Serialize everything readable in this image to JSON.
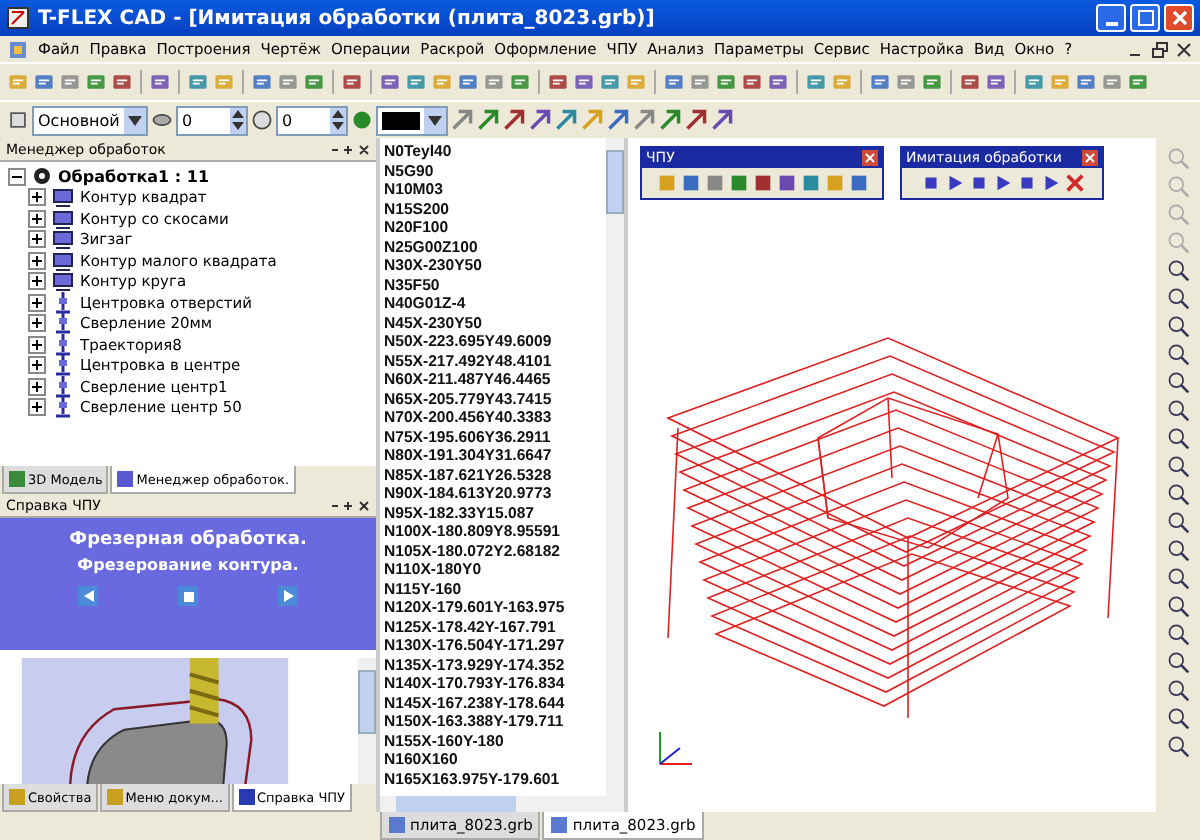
{
  "window": {
    "title": "T-FLEX CAD - [Имитация обработки (плита_8023.grb)]"
  },
  "menu": [
    "Файл",
    "Правка",
    "Построения",
    "Чертёж",
    "Операции",
    "Раскрой",
    "Оформление",
    "ЧПУ",
    "Анализ",
    "Параметры",
    "Сервис",
    "Настройка",
    "Вид",
    "Окно",
    "?"
  ],
  "toolbar": {
    "layer": "Основной",
    "level_1": "0",
    "level_2": "0"
  },
  "manager": {
    "title": "Менеджер обработок",
    "tree": [
      {
        "label": "Обработка1 : 11",
        "expanded": true,
        "children": [
          {
            "label": "Контур квадрат",
            "kind": "contour",
            "expanded": false
          },
          {
            "label": "Контур со скосами",
            "kind": "contour",
            "expanded": false
          },
          {
            "label": "Зигзаг",
            "kind": "contour",
            "expanded": false
          },
          {
            "label": "Контур малого квадрата",
            "kind": "contour",
            "expanded": false
          },
          {
            "label": "Контур круга",
            "kind": "contour",
            "expanded": false
          },
          {
            "label": "Центровка отверстий",
            "kind": "drill",
            "expanded": false
          },
          {
            "label": "Сверление 20мм",
            "kind": "drill",
            "expanded": false
          },
          {
            "label": "Траектория8",
            "kind": "drill",
            "expanded": false
          },
          {
            "label": "Центровка в центре",
            "kind": "drill",
            "expanded": false
          },
          {
            "label": "Сверление центр1",
            "kind": "drill",
            "expanded": false
          },
          {
            "label": "Сверление центр 50",
            "kind": "drill",
            "expanded": false
          }
        ]
      }
    ],
    "tabs": [
      {
        "label": "3D Модель",
        "selected": false
      },
      {
        "label": "Менеджер обработок.",
        "selected": true
      }
    ]
  },
  "help": {
    "title": "Справка ЧПУ",
    "heading": "Фрезерная обработка.",
    "subheading": "Фрезерование контура.",
    "tabs": [
      {
        "label": "Свойства",
        "selected": false
      },
      {
        "label": "Меню докум...",
        "selected": false
      },
      {
        "label": "Справка ЧПУ",
        "selected": true
      }
    ]
  },
  "code": {
    "lines": [
      "N0Teyl40",
      "N5G90",
      "N10M03",
      "N15S200",
      "N20F100",
      "N25G00Z100",
      "N30X-230Y50",
      "N35F50",
      "N40G01Z-4",
      "N45X-230Y50",
      "N50X-223.695Y49.6009",
      "N55X-217.492Y48.4101",
      "N60X-211.487Y46.4465",
      "N65X-205.779Y43.7415",
      "N70X-200.456Y40.3383",
      "N75X-195.606Y36.2911",
      "N80X-191.304Y31.6647",
      "N85X-187.621Y26.5328",
      "N90X-184.613Y20.9773",
      "N95X-182.33Y15.087",
      "N100X-180.809Y8.95591",
      "N105X-180.072Y2.68182",
      "N110X-180Y0",
      "N115Y-160",
      "N120X-179.601Y-163.975",
      "N125X-178.42Y-167.791",
      "N130X-176.504Y-171.297",
      "N135X-173.929Y-174.352",
      "N140X-170.793Y-176.834",
      "N145X-167.238Y-178.644",
      "N150X-163.388Y-179.711",
      "N155X-160Y-180",
      "N160X160",
      "N165X163.975Y-179.601"
    ],
    "tabs": [
      {
        "label": "плита_8023.grb",
        "selected": false
      },
      {
        "label": "плита_8023.grb",
        "selected": true
      }
    ]
  },
  "floating_toolbars": [
    {
      "title": "ЧПУ"
    },
    {
      "title": "Имитация обработки"
    }
  ]
}
